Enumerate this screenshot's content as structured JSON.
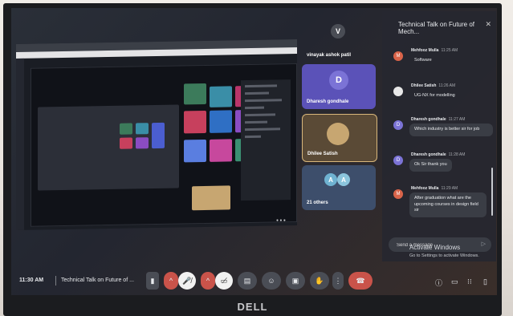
{
  "meeting": {
    "time": "11:30 AM",
    "title": "Technical Talk on Future of ...",
    "panel_title": "Technical Talk on Future of Mech..."
  },
  "participants": [
    {
      "name": "vinayak ashok patil",
      "initial": "V",
      "color": "#3c4043"
    },
    {
      "name": "Dharesh gondhale",
      "initial": "D",
      "color": "#7b73d6"
    },
    {
      "name": "Dhilee Satish",
      "initial": "",
      "color": "#c7a671"
    },
    {
      "name": "21 others",
      "initial": "A",
      "color": "#6fb2d1"
    }
  ],
  "chat": {
    "messages": [
      {
        "sender": "Mehfooz Mulla",
        "time": "11:25 AM",
        "text": "Software",
        "initial": "M",
        "color": "#d9644a"
      },
      {
        "sender": "Dhilee Satish",
        "time": "11:26 AM",
        "text": "UG-NX for modelling",
        "initial": "",
        "color": "#e8e8e8"
      },
      {
        "sender": "Dharesh gondhale",
        "time": "11:27 AM",
        "text": "Which industry is better sir for job",
        "initial": "D",
        "color": "#7b73d6"
      },
      {
        "sender": "Dharesh gondhale",
        "time": "11:28 AM",
        "text": "Ok Sir thank you",
        "initial": "D",
        "color": "#7b73d6"
      },
      {
        "sender": "Mehfooz Mulla",
        "time": "11:29 AM",
        "text": "After graduation what are the upcoming courses in design field sir",
        "initial": "M",
        "color": "#d9644a"
      }
    ],
    "input_placeholder": "Send a message"
  },
  "watermark": {
    "line1": "Activate Windows",
    "line2": "Go to Settings to activate Windows."
  },
  "brand": "DELL",
  "icons": {
    "close": "close-icon",
    "send": "send-icon",
    "mic_off": "mic-off-icon",
    "camera_off": "camera-off-icon",
    "present": "present-icon",
    "emoji": "emoji-icon",
    "captions": "captions-icon",
    "raise_hand": "raise-hand-icon",
    "more": "more-icon",
    "end_call": "end-call-icon",
    "info": "info-icon",
    "chat": "chat-icon",
    "activities": "activities-icon",
    "lock": "lock-icon"
  },
  "colors": {
    "end_call": "#c9534a",
    "panel_bg": "#26282f",
    "accent_purple": "#7b73d6"
  }
}
